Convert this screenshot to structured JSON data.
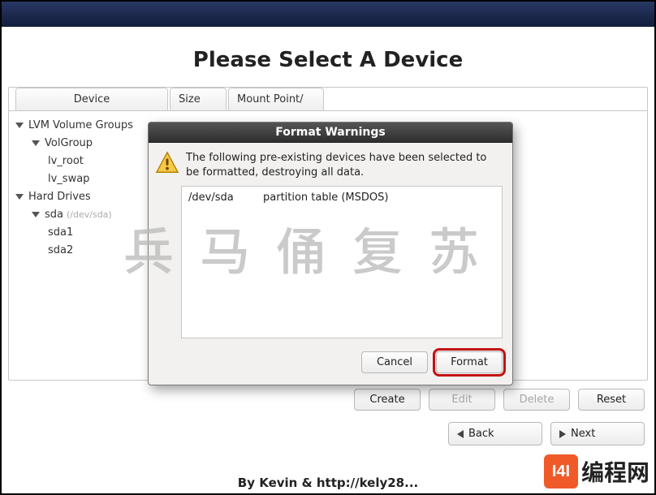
{
  "page_title": "Please Select A Device",
  "columns": {
    "device": "Device",
    "size": "Size",
    "mount": "Mount Point/"
  },
  "tree": {
    "lvm_group_header": "LVM Volume Groups",
    "volgroup": "VolGroup",
    "lv_root": "lv_root",
    "lv_swap": "lv_swap",
    "hard_drives_header": "Hard Drives",
    "sda": "sda",
    "sda_hint": "(/dev/sda)",
    "sda1": "sda1",
    "sda2": "sda2"
  },
  "buttons": {
    "create": "Create",
    "edit": "Edit",
    "delete": "Delete",
    "reset": "Reset",
    "back": "Back",
    "next": "Next"
  },
  "dialog": {
    "title": "Format Warnings",
    "message": "The following pre-existing devices have been selected to be formatted, destroying all data.",
    "device": "/dev/sda",
    "desc": "partition table (MSDOS)",
    "cancel": "Cancel",
    "format": "Format"
  },
  "watermark": "兵马俑复苏",
  "attribution": "By Kevin & http://kely28...",
  "site_logo": {
    "badge": "I4I",
    "text": "编程网"
  }
}
